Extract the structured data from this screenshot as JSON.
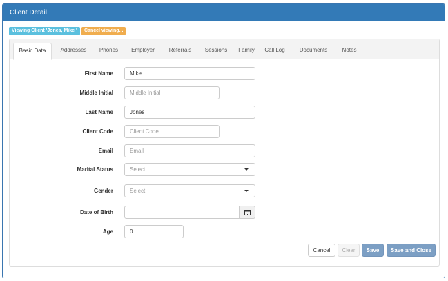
{
  "header": {
    "title": "Client Detail"
  },
  "status": {
    "viewing_label": "Viewing Client 'Jones, Mike '",
    "cancel_label": "Cancel viewing..."
  },
  "tabs": [
    {
      "label": "Basic Data",
      "active": true
    },
    {
      "label": "Addresses"
    },
    {
      "label": "Phones"
    },
    {
      "label": "Employer"
    },
    {
      "label": "Referrals"
    },
    {
      "label": "Sessions"
    },
    {
      "label": "Family"
    },
    {
      "label": "Call Log"
    },
    {
      "label": "Documents"
    },
    {
      "label": "Notes"
    }
  ],
  "form": {
    "first_name": {
      "label": "First Name",
      "value": "Mike"
    },
    "middle_initial": {
      "label": "Middle Initial",
      "value": "",
      "placeholder": "Middle Initial"
    },
    "last_name": {
      "label": "Last Name",
      "value": "Jones"
    },
    "client_code": {
      "label": "Client Code",
      "value": "",
      "placeholder": "Client Code"
    },
    "email": {
      "label": "Email",
      "value": "",
      "placeholder": "Email"
    },
    "marital_status": {
      "label": "Marital Status",
      "selected": "Select"
    },
    "gender": {
      "label": "Gender",
      "selected": "Select"
    },
    "date_of_birth": {
      "label": "Date of Birth",
      "value": ""
    },
    "age": {
      "label": "Age",
      "value": "0"
    }
  },
  "buttons": {
    "cancel": "Cancel",
    "clear": "Clear",
    "save": "Save",
    "save_close": "Save and Close"
  },
  "icons": {
    "calendar": "calendar-icon",
    "caret": "caret-down-icon"
  },
  "colors": {
    "header": "#337ab7",
    "info": "#5bc0de",
    "warning": "#f0ad4e",
    "primary": "#7c9fc4"
  }
}
